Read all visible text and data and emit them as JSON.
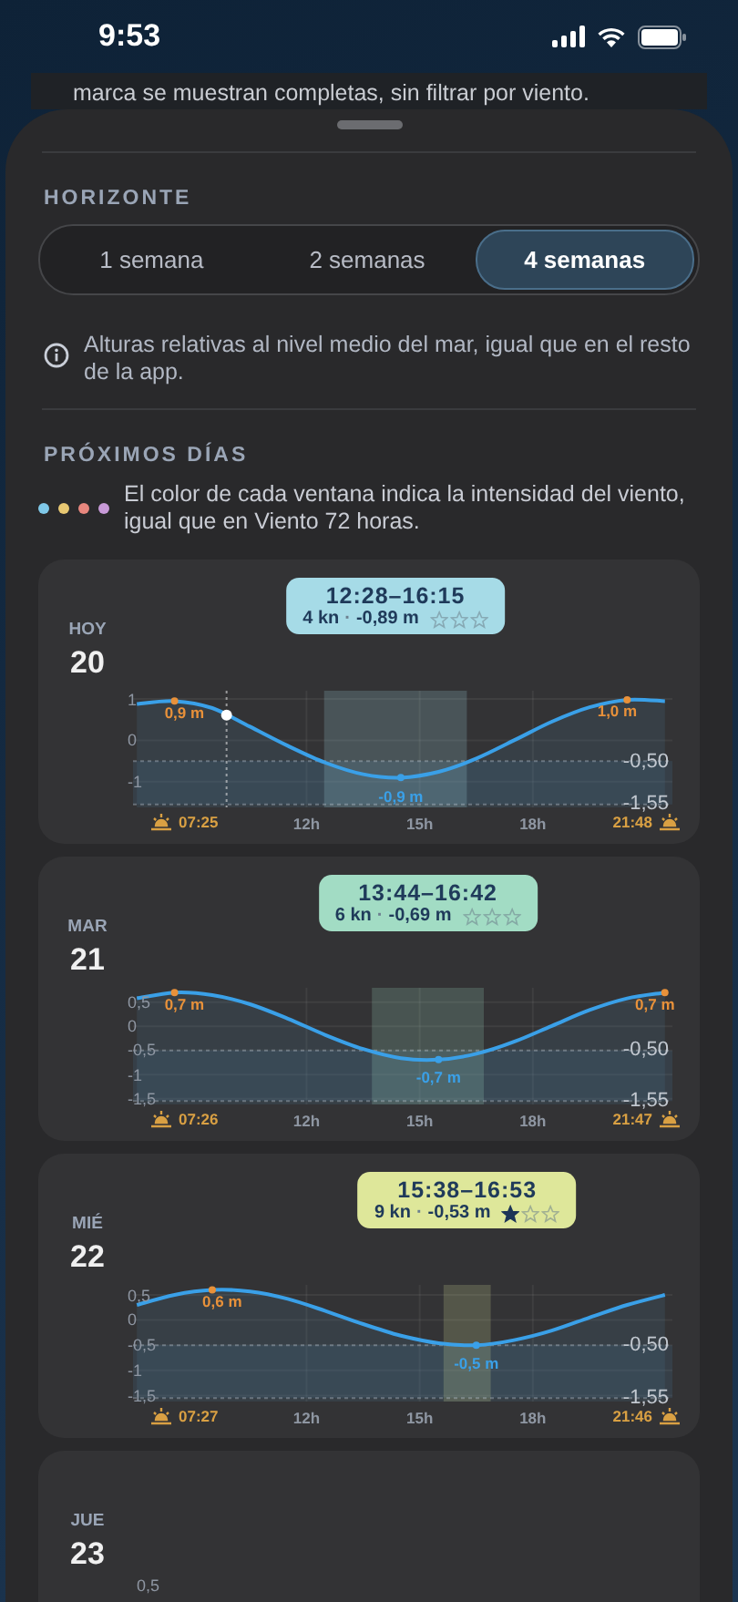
{
  "status_bar": {
    "time": "9:53"
  },
  "behind_text": "marca se muestran completas, sin filtrar por viento.",
  "horizon": {
    "heading": "HORIZONTE",
    "tabs": [
      {
        "label": "1 semana",
        "selected": false
      },
      {
        "label": "2 semanas",
        "selected": false
      },
      {
        "label": "4 semanas",
        "selected": true
      }
    ],
    "info": "Alturas relativas al nivel medio del mar, igual que en el resto de la app."
  },
  "upcoming": {
    "heading": "PRÓXIMOS DÍAS",
    "legend_colors": [
      {
        "color": "#7fc8e8"
      },
      {
        "color": "#e8c872"
      },
      {
        "color": "#e8877e"
      },
      {
        "color": "#c89ad8"
      }
    ],
    "legend_text": "El color de cada ventana indica la intensidad del viento, igual que en Viento 72 horas."
  },
  "days": [
    {
      "weekday": "HOY",
      "day": "20",
      "window": {
        "time": "12:28–16:15",
        "wind": "4 kn",
        "separator": "·",
        "height": "-0,89 m",
        "stars": 0,
        "color": "#a6dbe7"
      },
      "chart_data": {
        "type": "line",
        "x": [
          7.5,
          8.5,
          9.5,
          10.5,
          11.5,
          12.5,
          13.5,
          14.5,
          15.5,
          16.5,
          17.5,
          18.5,
          19.5,
          20.5,
          21.5
        ],
        "xlim": [
          7.4,
          21.7
        ],
        "ylim": [
          -1.62,
          1.2
        ],
        "series": [
          {
            "color": "#3aa0e8",
            "values": [
              0.88,
              0.95,
              0.78,
              0.33,
              -0.13,
              -0.54,
              -0.82,
              -0.9,
              -0.76,
              -0.44,
              0.0,
              0.45,
              0.8,
              0.98,
              0.95
            ]
          }
        ],
        "xticks": [
          {
            "value": 12,
            "label": "12h"
          },
          {
            "value": 15,
            "label": "15h"
          },
          {
            "value": 18,
            "label": "18h"
          }
        ],
        "yticks": [
          {
            "value": 1,
            "label": "1"
          },
          {
            "value": 0,
            "label": "0"
          },
          {
            "value": -1,
            "label": "-1"
          }
        ],
        "grid": true,
        "ref_lines": [
          {
            "axis": "y",
            "value": -0.5,
            "label": "-0,50"
          },
          {
            "axis": "y",
            "value": -1.55,
            "label": "-1,55"
          },
          {
            "axis": "x",
            "value": 9.88
          }
        ]
      },
      "peaks": [
        {
          "kind": "high",
          "label": "0,9 m"
        },
        {
          "kind": "low",
          "label": "-0,9 m"
        },
        {
          "kind": "high",
          "label": "1,0 m"
        }
      ],
      "sunrise": "07:25",
      "sunset": "21:48"
    },
    {
      "weekday": "MAR",
      "day": "21",
      "window": {
        "time": "13:44–16:42",
        "wind": "6 kn",
        "separator": "·",
        "height": "-0,69 m",
        "stars": 0,
        "color": "#a2dcc4"
      },
      "chart_data": {
        "type": "line",
        "x": [
          7.5,
          8.5,
          9.5,
          10.5,
          11.5,
          12.5,
          13.5,
          14.5,
          15.5,
          16.5,
          17.5,
          18.5,
          19.5,
          20.5,
          21.5
        ],
        "xlim": [
          7.4,
          21.7
        ],
        "ylim": [
          -1.62,
          0.8
        ],
        "series": [
          {
            "color": "#3aa0e8",
            "values": [
              0.58,
              0.7,
              0.65,
              0.46,
              0.16,
              -0.18,
              -0.47,
              -0.66,
              -0.69,
              -0.57,
              -0.32,
              0.01,
              0.34,
              0.58,
              0.7
            ]
          }
        ],
        "xticks": [
          {
            "value": 12,
            "label": "12h"
          },
          {
            "value": 15,
            "label": "15h"
          },
          {
            "value": 18,
            "label": "18h"
          }
        ],
        "yticks": [
          {
            "value": 0.5,
            "label": "0,5"
          },
          {
            "value": 0,
            "label": "0"
          },
          {
            "value": -0.5,
            "label": "-0,5"
          },
          {
            "value": -1,
            "label": "-1"
          },
          {
            "value": -1.5,
            "label": "-1,5"
          }
        ],
        "grid": true,
        "ref_lines": [
          {
            "axis": "y",
            "value": -0.5,
            "label": "-0,50"
          },
          {
            "axis": "y",
            "value": -1.55,
            "label": "-1,55"
          }
        ]
      },
      "peaks": [
        {
          "kind": "high",
          "label": "0,7 m"
        },
        {
          "kind": "low",
          "label": "-0,7 m"
        },
        {
          "kind": "high",
          "label": "0,7 m"
        }
      ],
      "sunrise": "07:26",
      "sunset": "21:47"
    },
    {
      "weekday": "MIÉ",
      "day": "22",
      "window": {
        "time": "15:38–16:53",
        "wind": "9 kn",
        "separator": "·",
        "height": "-0,53 m",
        "stars": 1,
        "color": "#dee79a"
      },
      "chart_data": {
        "type": "line",
        "x": [
          7.5,
          8.5,
          9.5,
          10.5,
          11.5,
          12.5,
          13.5,
          14.5,
          15.5,
          16.5,
          17.5,
          18.5,
          19.5,
          20.5,
          21.5
        ],
        "xlim": [
          7.4,
          21.7
        ],
        "ylim": [
          -1.62,
          0.7
        ],
        "series": [
          {
            "color": "#3aa0e8",
            "values": [
              0.3,
              0.5,
              0.6,
              0.57,
              0.42,
              0.18,
              -0.08,
              -0.31,
              -0.46,
              -0.5,
              -0.4,
              -0.21,
              0.05,
              0.3,
              0.5
            ]
          }
        ],
        "xticks": [
          {
            "value": 12,
            "label": "12h"
          },
          {
            "value": 15,
            "label": "15h"
          },
          {
            "value": 18,
            "label": "18h"
          }
        ],
        "yticks": [
          {
            "value": 0.5,
            "label": "0,5"
          },
          {
            "value": 0,
            "label": "0"
          },
          {
            "value": -0.5,
            "label": "-0,5"
          },
          {
            "value": -1,
            "label": "-1"
          },
          {
            "value": -1.5,
            "label": "-1,5"
          }
        ],
        "grid": true,
        "ref_lines": [
          {
            "axis": "y",
            "value": -0.5,
            "label": "-0,50"
          },
          {
            "axis": "y",
            "value": -1.55,
            "label": "-1,55"
          }
        ]
      },
      "peaks": [
        {
          "kind": "high",
          "label": "0,6 m"
        },
        {
          "kind": "low",
          "label": "-0,5 m"
        }
      ],
      "sunrise": "07:27",
      "sunset": "21:46"
    },
    {
      "weekday": "JUE",
      "day": "23",
      "y_ticks": [
        "0,5"
      ]
    }
  ]
}
